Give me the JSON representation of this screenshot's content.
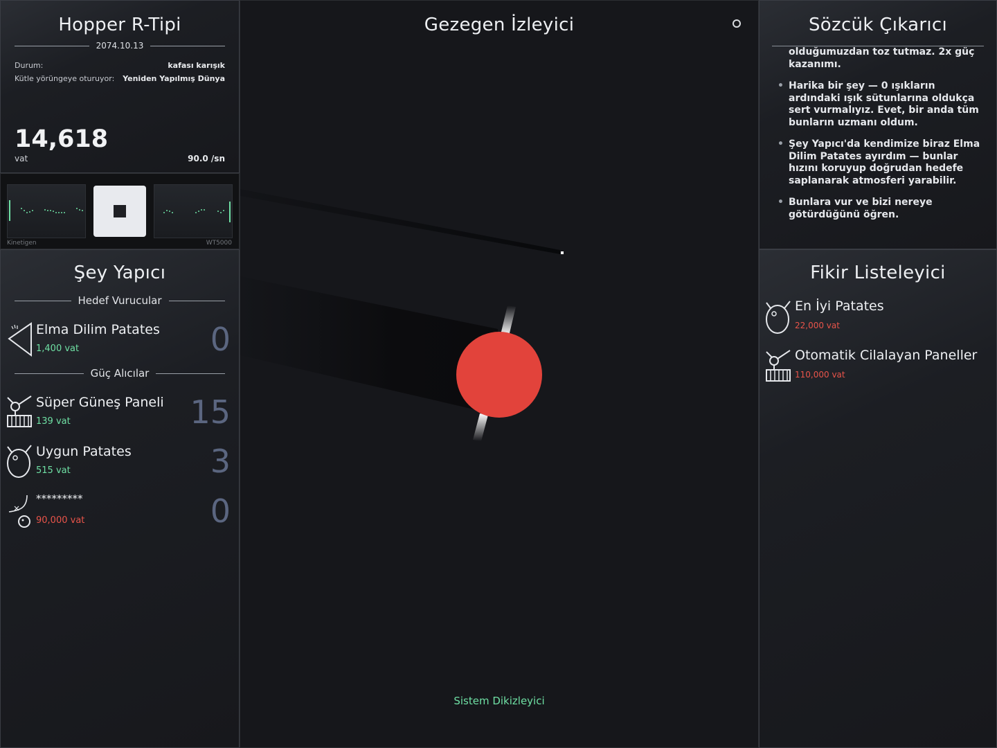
{
  "hopper": {
    "title": "Hopper R-Tipi",
    "date": "2074.10.13",
    "status_label": "Durum:",
    "status_value": "kafası karışık",
    "orbit_label": "Kütle yörüngeye oturuyor:",
    "orbit_value": "Yeniden Yapılmış Dünya",
    "energy": "14,618",
    "energy_unit": "vat",
    "rate": "90.0 /sn"
  },
  "strip": {
    "left_label": "Kinetigen",
    "right_label": "WT5000",
    "stop_icon": "stop-icon"
  },
  "maker": {
    "title": "Şey Yapıcı",
    "section_targets": "Hedef Vurucular",
    "section_power": "Güç Alıcılar",
    "targets": [
      {
        "name": "Elma Dilim Patates",
        "price": "1,400 vat",
        "count": "0",
        "icon": "wedge-icon"
      }
    ],
    "power": [
      {
        "name": "Süper Güneş Paneli",
        "price": "139 vat",
        "count": "15",
        "icon": "solar-panel-icon"
      },
      {
        "name": "Uygun Patates",
        "price": "515 vat",
        "count": "3",
        "icon": "potato-icon"
      },
      {
        "name": "*********",
        "price": "90,000 vat",
        "count": "0",
        "icon": "locked-item-icon",
        "price_color": "#e9544a"
      }
    ]
  },
  "center": {
    "title": "Gezegen İzleyici",
    "footer": "Sistem Dikizleyici",
    "planet_color": "#e2433b",
    "settings_icon": "ring-icon"
  },
  "words": {
    "title": "Sözcük Çıkarıcı",
    "paragraphs": [
      "olduğumuzdan toz tutmaz. 2x güç kazanımı.",
      "Harika bir şey — 0 ışıkların ardındaki ışık sütunlarına oldukça sert vurmalıyız. Evet, bir anda tüm bunların uzmanı oldum.",
      "Şey Yapıcı'da kendimize biraz Elma Dilim Patates ayırdım — bunlar hızını koruyup doğrudan hedefe saplanarak atmosferi yarabilir.",
      "Bunlara vur ve bizi nereye götürdüğünü öğren."
    ]
  },
  "ideas": {
    "title": "Fikir Listeleyici",
    "items": [
      {
        "name": "En İyi Patates",
        "price": "22,000 vat",
        "icon": "potato-icon"
      },
      {
        "name": "Otomatik Cilalayan Paneller",
        "price": "110,000 vat",
        "icon": "solar-panel-icon"
      }
    ]
  }
}
